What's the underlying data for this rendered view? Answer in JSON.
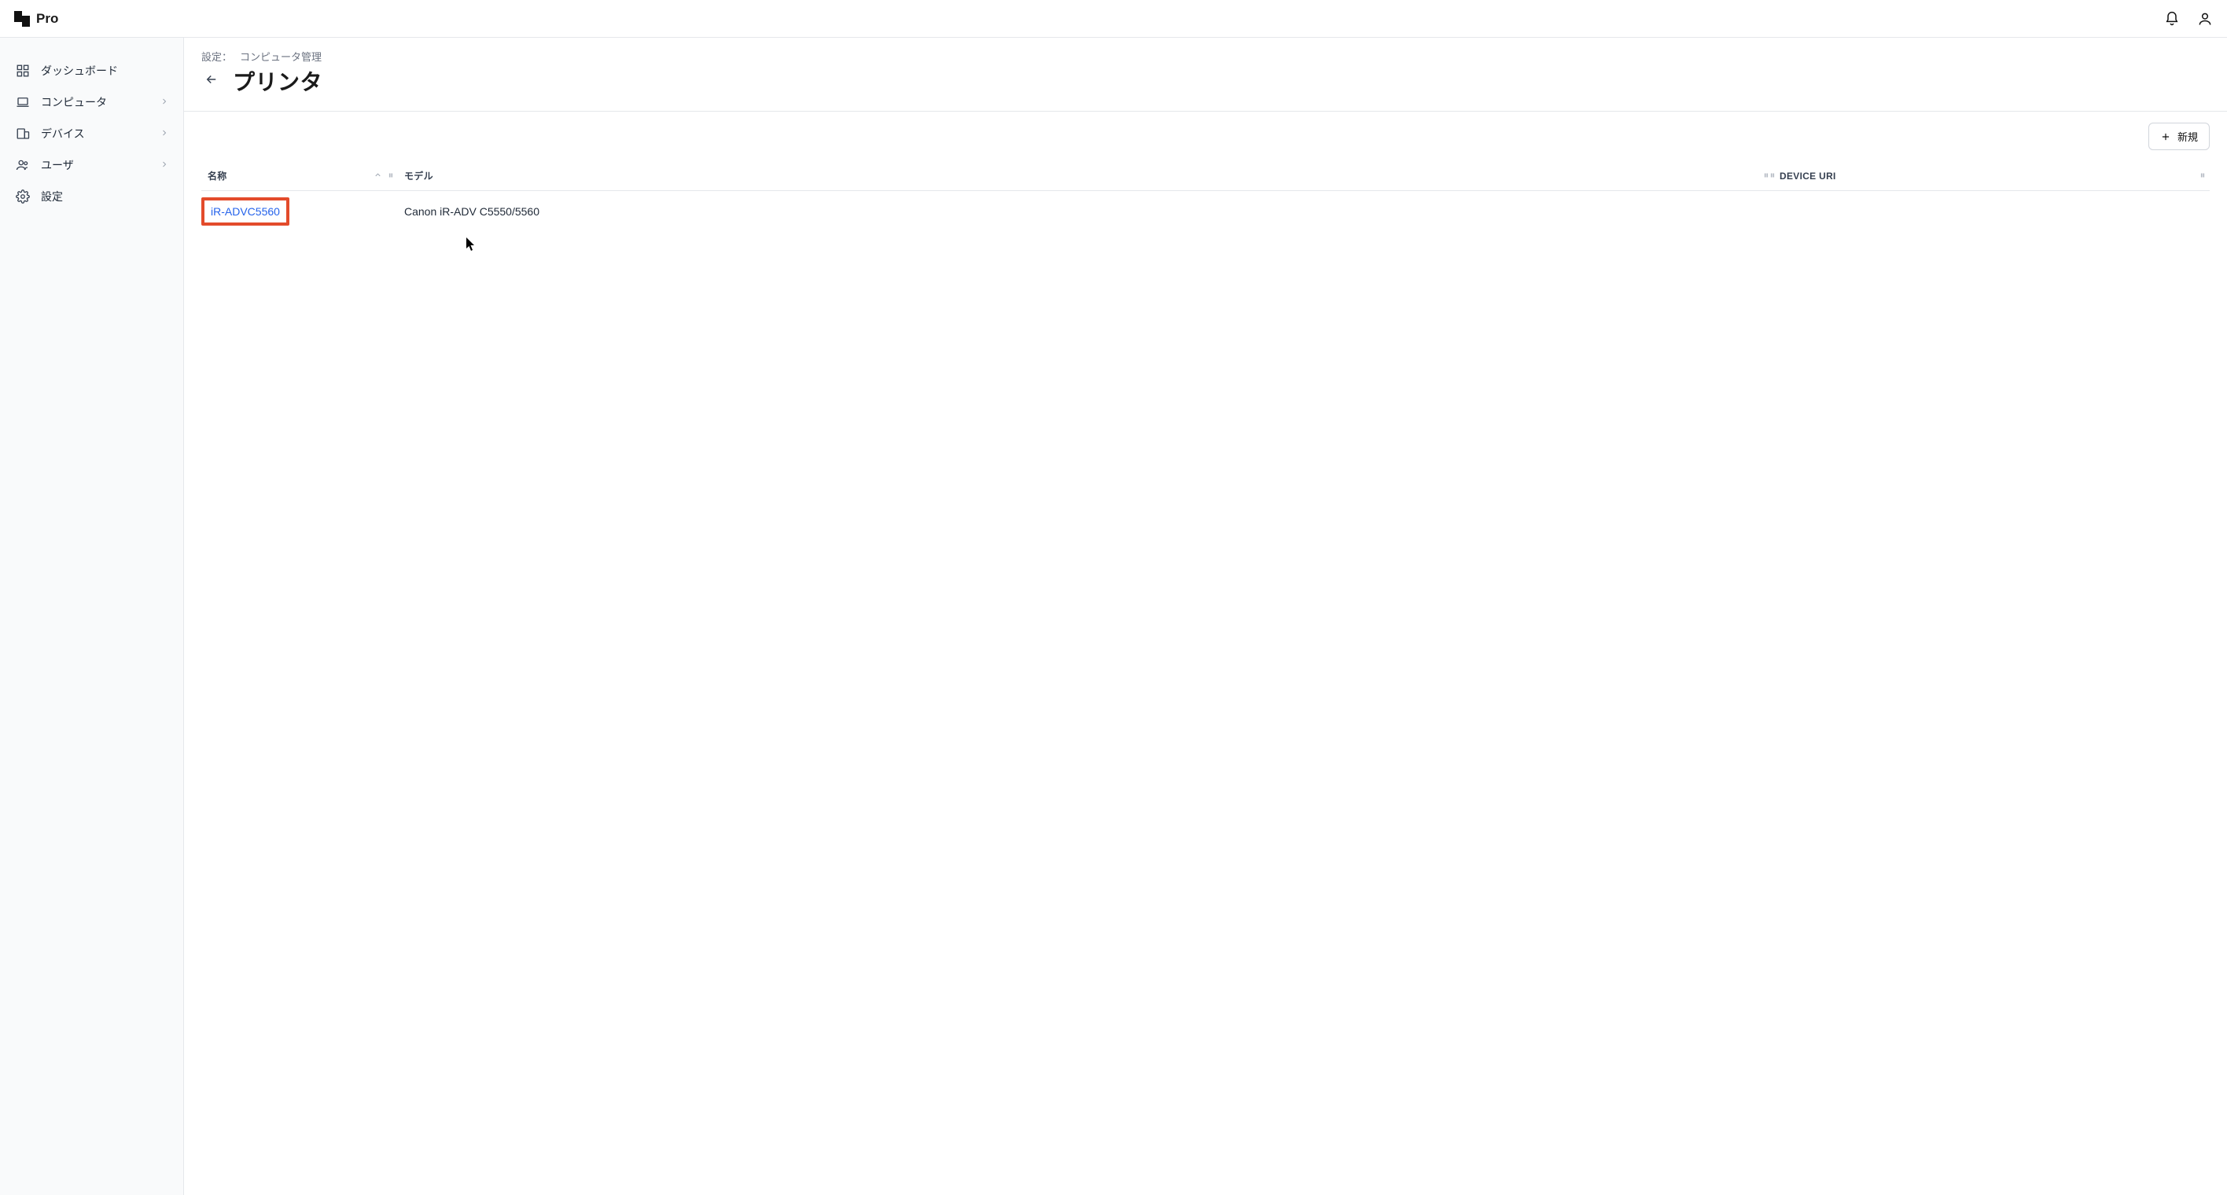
{
  "brand": {
    "name": "Pro"
  },
  "sidebar": {
    "items": [
      {
        "label": "ダッシュボード",
        "expandable": false
      },
      {
        "label": "コンピュータ",
        "expandable": true
      },
      {
        "label": "デバイス",
        "expandable": true
      },
      {
        "label": "ユーザ",
        "expandable": true
      },
      {
        "label": "設定",
        "expandable": false
      }
    ]
  },
  "breadcrumb": {
    "part1": "設定：",
    "part2": "コンピュータ管理"
  },
  "page": {
    "title": "プリンタ"
  },
  "actions": {
    "new_label": "新規"
  },
  "table": {
    "columns": {
      "name": "名称",
      "model": "モデル",
      "device_uri": "DEVICE URI"
    },
    "rows": [
      {
        "name": "iR-ADVC5560",
        "model": "Canon iR-ADV C5550/5560",
        "device_uri": ""
      }
    ]
  }
}
